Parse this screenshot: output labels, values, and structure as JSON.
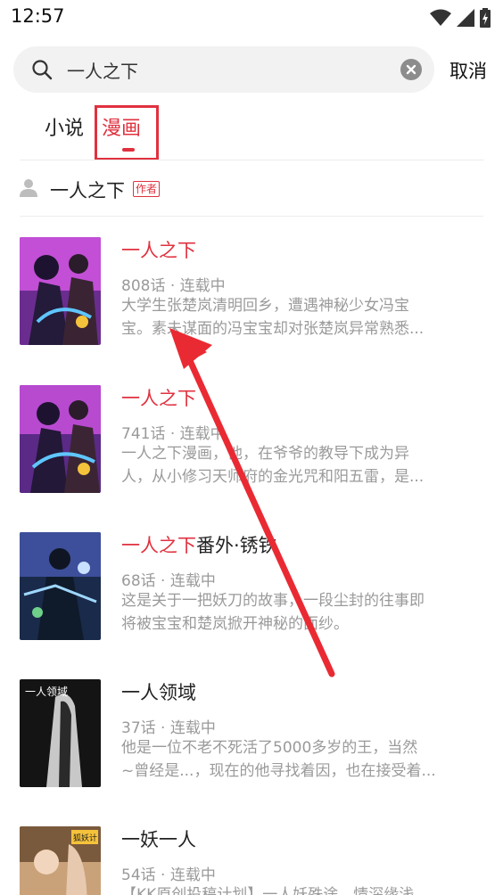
{
  "status_bar": {
    "time": "12:57"
  },
  "search": {
    "value": "一人之下",
    "cancel_label": "取消"
  },
  "tabs": [
    {
      "label": "小说"
    },
    {
      "label": "漫画"
    }
  ],
  "author": {
    "name": "一人之下",
    "tag": "作者"
  },
  "results": [
    {
      "title_hl": "一人之下",
      "title_rest": "",
      "meta": "808话 · 连载中",
      "desc1": "大学生张楚岚清明回乡，遭遇神秘少女冯宝",
      "desc2": "宝。素未谋面的冯宝宝却对张楚岚异常熟悉..."
    },
    {
      "title_hl": "一人之下",
      "title_rest": "",
      "meta": "741话 · 连载中",
      "desc1": "一人之下漫画，他，在爷爷的教导下成为异",
      "desc2": "人，从小修习天师府的金光咒和阳五雷，是..."
    },
    {
      "title_hl": "一人之下",
      "title_rest": "番外·锈铁",
      "meta": "68话 · 连载中",
      "desc1": "这是关于一把妖刀的故事，一段尘封的往事即",
      "desc2": "将被宝宝和楚岚掀开神秘的面纱。"
    },
    {
      "title_hl": "",
      "title_rest": "一人领域",
      "meta": "37话 · 连载中",
      "desc1": "他是一位不老不死活了5000多岁的王，当然",
      "desc2": "~曾经是...，现在的他寻找着因，也在接受着..."
    },
    {
      "title_hl": "",
      "title_rest": "一妖一人",
      "meta": "54话 · 连载中",
      "desc1": "【KK原创投稿计划】一人妖殊途，情深缘浅",
      "desc2": ""
    }
  ],
  "cover_texts": {
    "c4": "一人领域",
    "c5": "狐妖计"
  },
  "colors": {
    "accent": "#e0313f",
    "meta_text": "#9a9a9a",
    "search_bg": "#f2f2f2"
  }
}
